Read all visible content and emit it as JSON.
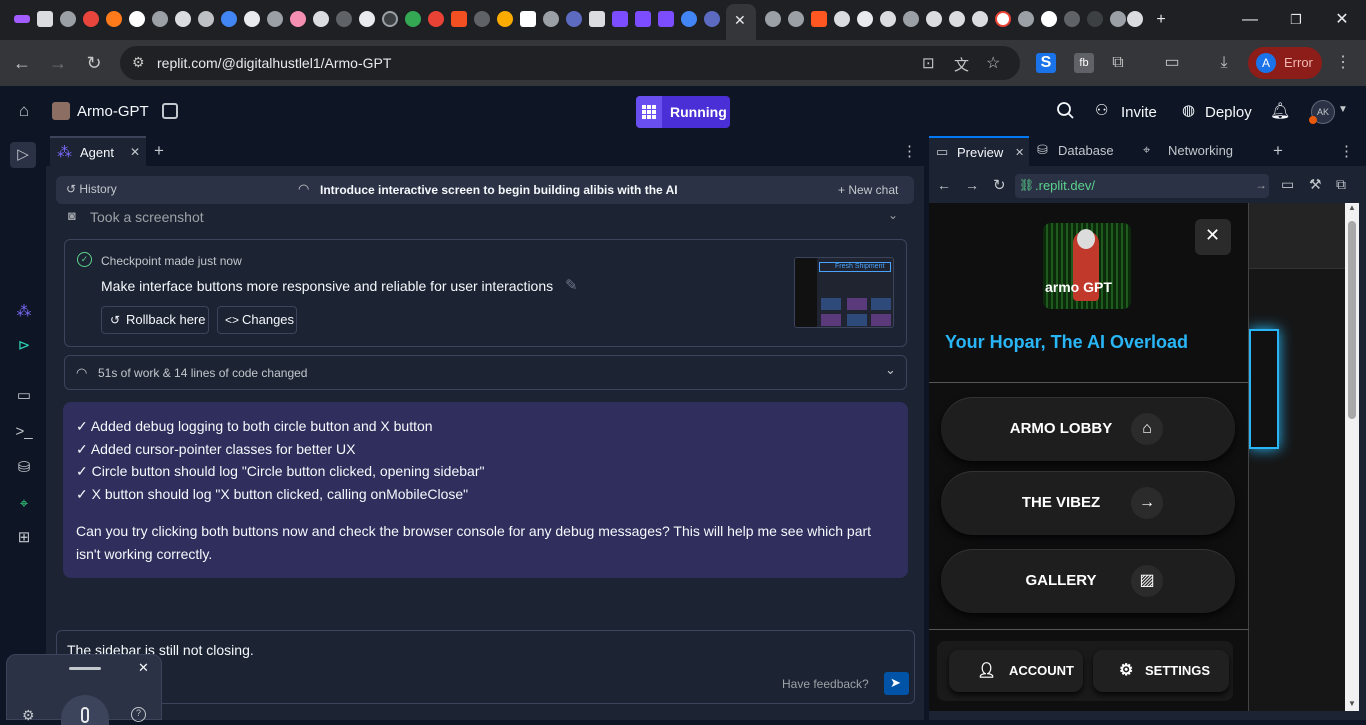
{
  "browser": {
    "url": "replit.com/@digitalhustlel1/Armo-GPT",
    "profile_initial": "A",
    "profile_status": "Error",
    "accent": "#8c1d18"
  },
  "header": {
    "project_name": "Armo-GPT",
    "run_status": "Running",
    "invite_label": "Invite",
    "deploy_label": "Deploy",
    "avatar_initials": "AK"
  },
  "agent": {
    "tab_label": "Agent",
    "history_label": "History",
    "history_title": "Introduce interactive screen to begin building alibis with the AI",
    "new_chat_label": "+ New chat",
    "screenshot_label": "Took a screenshot",
    "checkpoint_label": "Checkpoint made",
    "checkpoint_time": "just now",
    "checkpoint_title": "Make interface buttons more responsive and reliable for user interactions",
    "rollback_label": "Rollback here",
    "changes_label": "Changes",
    "work_summary": "51s of work & 14 lines of code changed",
    "message_lines": [
      "✓ Added debug logging to both circle button and X button",
      "✓ Added cursor-pointer classes for better UX",
      "✓ Circle button should log \"Circle button clicked, opening sidebar\"",
      "✓ X button should log \"X button clicked, calling onMobileClose\""
    ],
    "message_question": "Can you try clicking both buttons now and check the browser console for any debug messages? This will help me see which part isn't working correctly.",
    "input_value": "The sidebar is still not closing.",
    "feedback_label": "Have feedback?",
    "thumb_caption": "Fresh Shipment"
  },
  "preview": {
    "tabs": [
      "Preview",
      "Database",
      "Networking"
    ],
    "url": ".replit.dev/",
    "logo_text": "armo GPT",
    "tagline": "Your Hopar, The AI Overload",
    "menu": [
      {
        "label": "ARMO LOBBY",
        "icon": "home-icon"
      },
      {
        "label": "THE VIBEZ",
        "icon": "arrow-right-icon"
      },
      {
        "label": "GALLERY",
        "icon": "image-icon"
      }
    ],
    "account_label": "ACCOUNT",
    "settings_label": "SETTINGS",
    "tagline_color": "#29b6f6"
  }
}
